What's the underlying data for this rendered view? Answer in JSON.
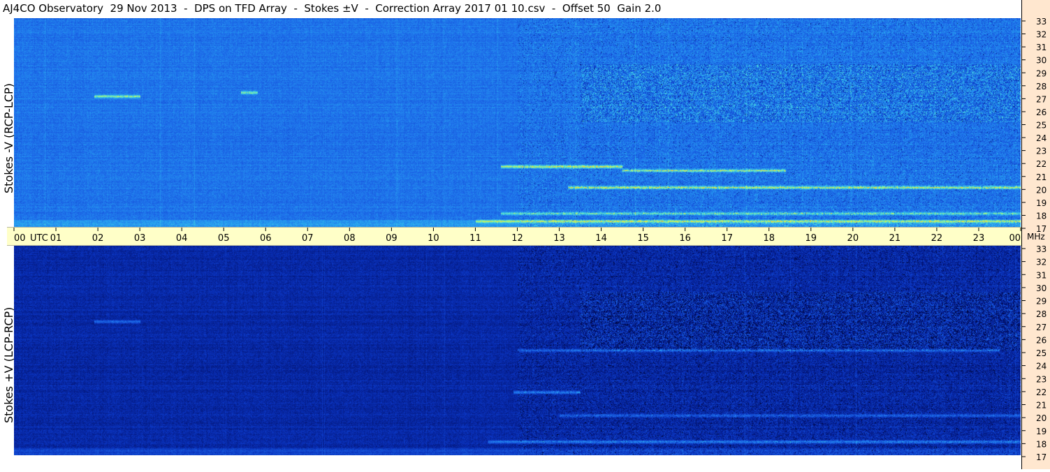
{
  "window": {
    "title": "AJ4CO Observatory  29 Nov 2013  -  DPS on TFD Array  -  Stokes ±V  -  Correction Array 2017 01 10.csv  -  Offset 50  Gain 2.0"
  },
  "chart_data": {
    "type": "heatmap",
    "title": "AJ4CO Observatory  29 Nov 2013  -  DPS on TFD Array  -  Stokes ±V  -  Correction Array 2017 01 10.csv  -  Offset 50  Gain 2.0",
    "x_axis": {
      "unit_label": "UTC",
      "end_label": "00",
      "ticks": [
        "00",
        "01",
        "02",
        "03",
        "04",
        "05",
        "06",
        "07",
        "08",
        "09",
        "10",
        "11",
        "12",
        "13",
        "14",
        "15",
        "16",
        "17",
        "18",
        "19",
        "20",
        "21",
        "22",
        "23",
        "00"
      ],
      "range_hours": [
        0,
        24
      ]
    },
    "y_axis": {
      "unit_label": "MHz",
      "ticks": [
        17,
        18,
        19,
        20,
        21,
        22,
        23,
        24,
        25,
        26,
        27,
        28,
        29,
        30,
        31,
        32,
        33
      ],
      "range_mhz": [
        17,
        33
      ]
    },
    "panels": [
      {
        "id": "top",
        "ylabel": "Stokes -V (RCP-LCP)",
        "base_color": "#1f6fe6",
        "emission_bands": [
          {
            "mhz": 27,
            "t_start": 1.9,
            "t_end": 3.0,
            "level": 0.85
          },
          {
            "mhz": 27.3,
            "t_start": 5.4,
            "t_end": 5.8,
            "level": 0.8
          },
          {
            "mhz": 21.6,
            "t_start": 11.6,
            "t_end": 14.5,
            "level": 1.0
          },
          {
            "mhz": 21.3,
            "t_start": 14.5,
            "t_end": 18.4,
            "level": 0.8
          },
          {
            "mhz": 20.0,
            "t_start": 13.2,
            "t_end": 24.0,
            "level": 0.9
          },
          {
            "mhz": 18.0,
            "t_start": 11.6,
            "t_end": 24.0,
            "level": 0.75
          },
          {
            "mhz": 17.4,
            "t_start": 11.0,
            "t_end": 24.0,
            "level": 0.7
          }
        ]
      },
      {
        "id": "bottom",
        "ylabel": "Stokes +V (LCP-RCP)",
        "base_color": "#0d2a9a",
        "emission_bands": [
          {
            "mhz": 27.2,
            "t_start": 1.9,
            "t_end": 3.0,
            "level": 0.6
          },
          {
            "mhz": 21.8,
            "t_start": 11.9,
            "t_end": 13.5,
            "level": 0.8
          },
          {
            "mhz": 25.0,
            "t_start": 12.0,
            "t_end": 23.5,
            "level": 0.6
          },
          {
            "mhz": 18.0,
            "t_start": 11.3,
            "t_end": 24.0,
            "level": 0.75
          },
          {
            "mhz": 20.0,
            "t_start": 13.0,
            "t_end": 24.0,
            "level": 0.5
          }
        ]
      }
    ]
  }
}
